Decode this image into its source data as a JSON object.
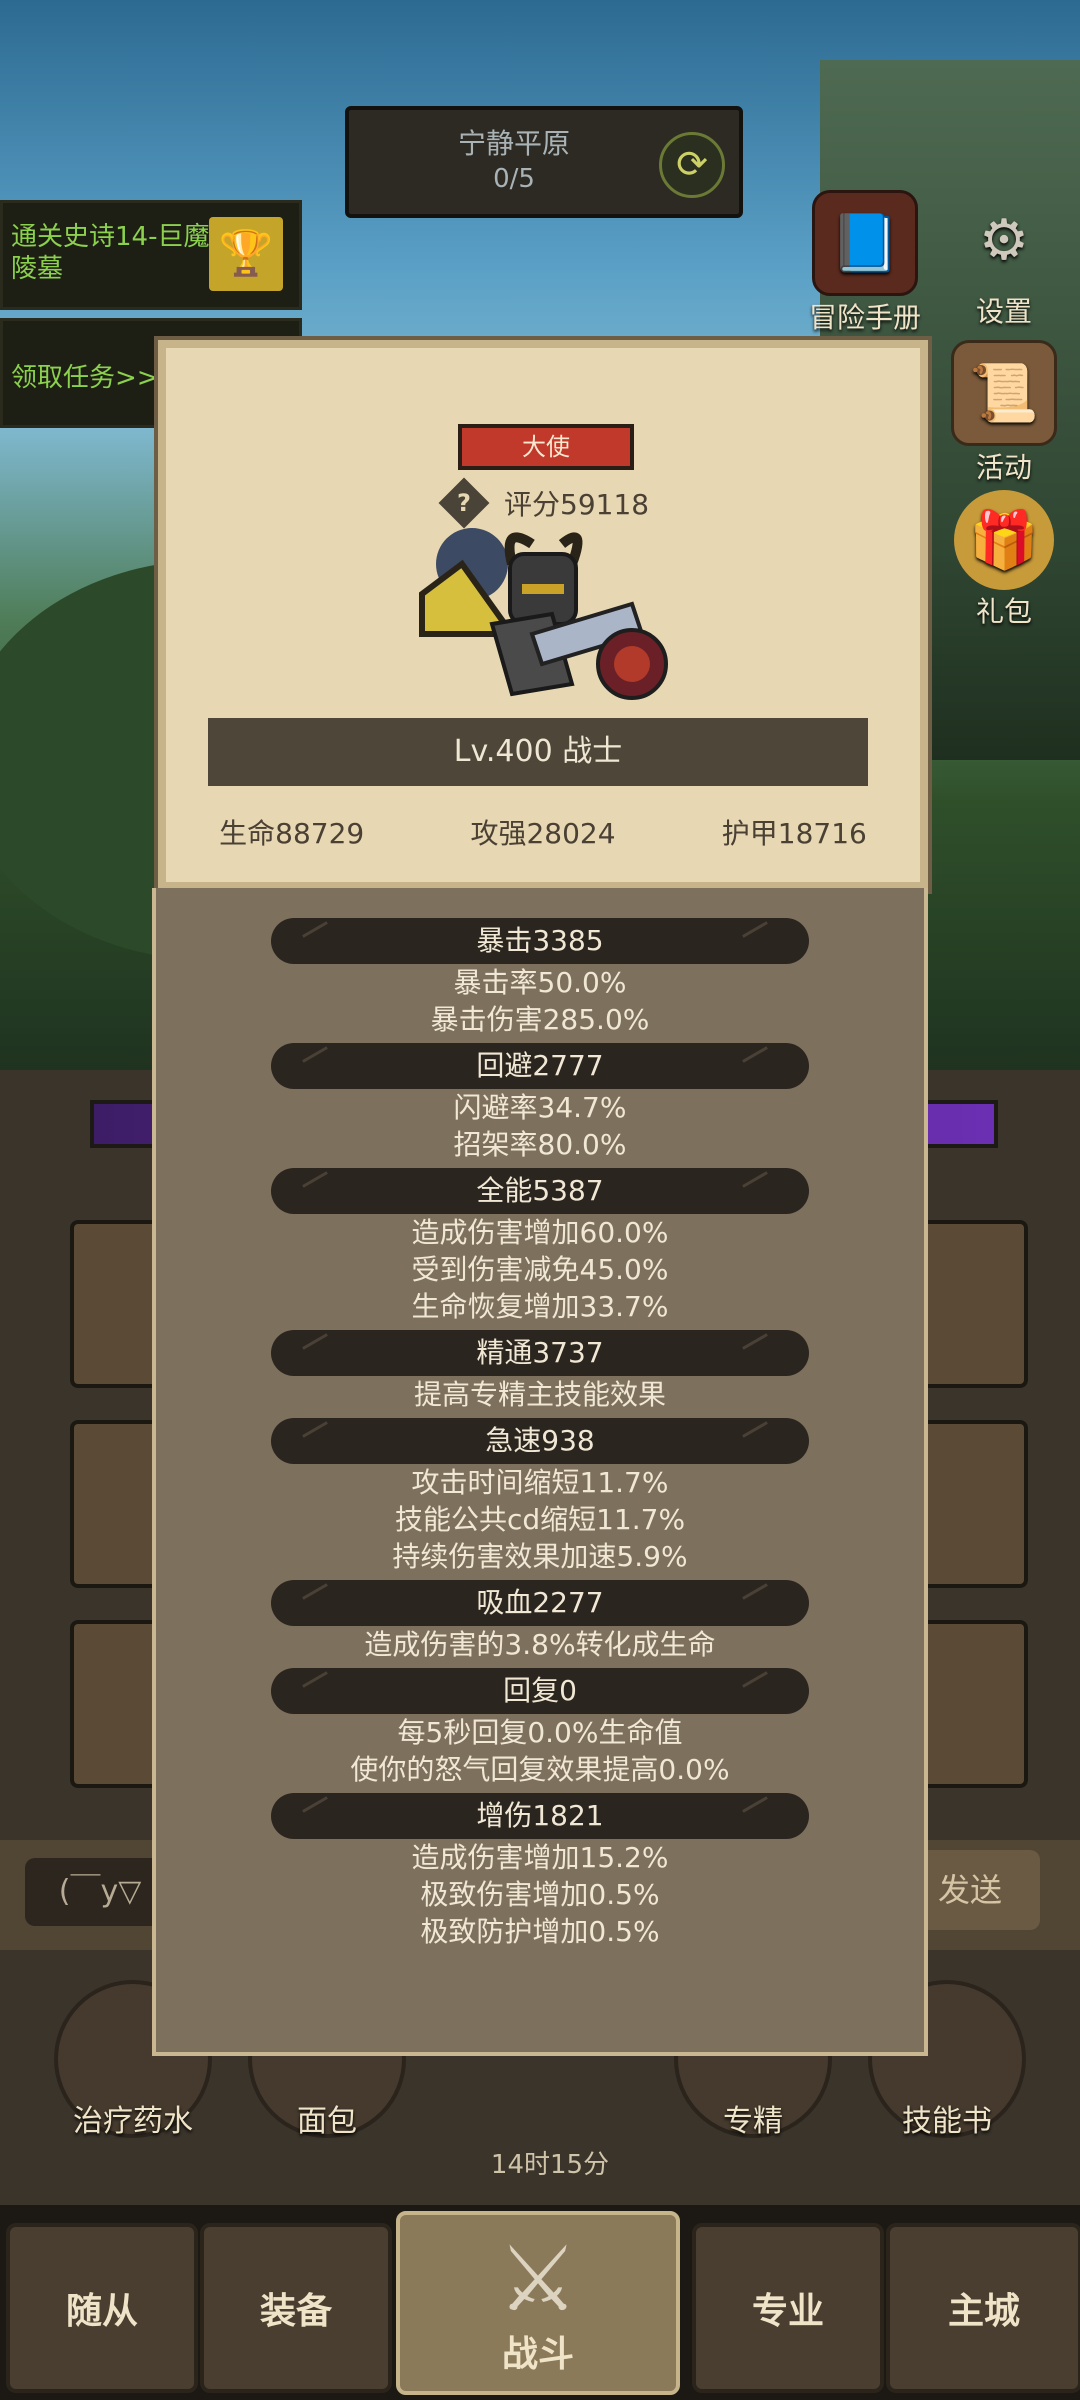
{
  "hud": {
    "area_name": "宁静平原",
    "area_progress": "0/5",
    "quest_text": "通关史诗14-巨魔陵墓",
    "task_text": "领取任务>>"
  },
  "side_buttons": [
    {
      "label": "冒险手册",
      "icon": "book-icon"
    },
    {
      "label": "设置",
      "icon": "gear-icon"
    },
    {
      "label": "活动",
      "icon": "scroll-icon"
    },
    {
      "label": "礼包",
      "icon": "gift-icon"
    }
  ],
  "character": {
    "badge": "大使",
    "score": "评分59118",
    "level": "Lv.400 战士",
    "hp": "生命88729",
    "attack": "攻强28024",
    "armor": "护甲18716"
  },
  "stats": [
    {
      "title": "暴击3385",
      "lines": [
        "暴击率50.0%",
        "暴击伤害285.0%"
      ]
    },
    {
      "title": "回避2777",
      "lines": [
        "闪避率34.7%",
        "招架率80.0%"
      ]
    },
    {
      "title": "全能5387",
      "lines": [
        "造成伤害增加60.0%",
        "受到伤害减免45.0%",
        "生命恢复增加33.7%"
      ]
    },
    {
      "title": "精通3737",
      "lines": [
        "提高专精主技能效果"
      ]
    },
    {
      "title": "急速938",
      "lines": [
        "攻击时间缩短11.7%",
        "技能公共cd缩短11.7%",
        "持续伤害效果加速5.9%"
      ]
    },
    {
      "title": "吸血2277",
      "lines": [
        "造成伤害的3.8%转化成生命"
      ]
    },
    {
      "title": "回复0",
      "lines": [
        "每5秒回复0.0%生命值",
        "使你的怒气回复效果提高0.0%"
      ]
    },
    {
      "title": "增伤1821",
      "lines": [
        "造成伤害增加15.2%",
        "极致伤害增加0.5%",
        "极致防护增加0.5%"
      ]
    }
  ],
  "chat": {
    "input_text": "(￣y▽",
    "send_label": "发送"
  },
  "utilities": [
    {
      "label": "治疗药水",
      "icon": "potion-icon"
    },
    {
      "label": "面包",
      "icon": "bread-icon"
    },
    {
      "label": "专精",
      "icon": "specialty-icon"
    },
    {
      "label": "技能书",
      "icon": "skillbook-icon"
    }
  ],
  "timer": "14时15分",
  "nav": {
    "followers": "随从",
    "equipment": "装备",
    "battle": "战斗",
    "profession": "专业",
    "city": "主城"
  }
}
